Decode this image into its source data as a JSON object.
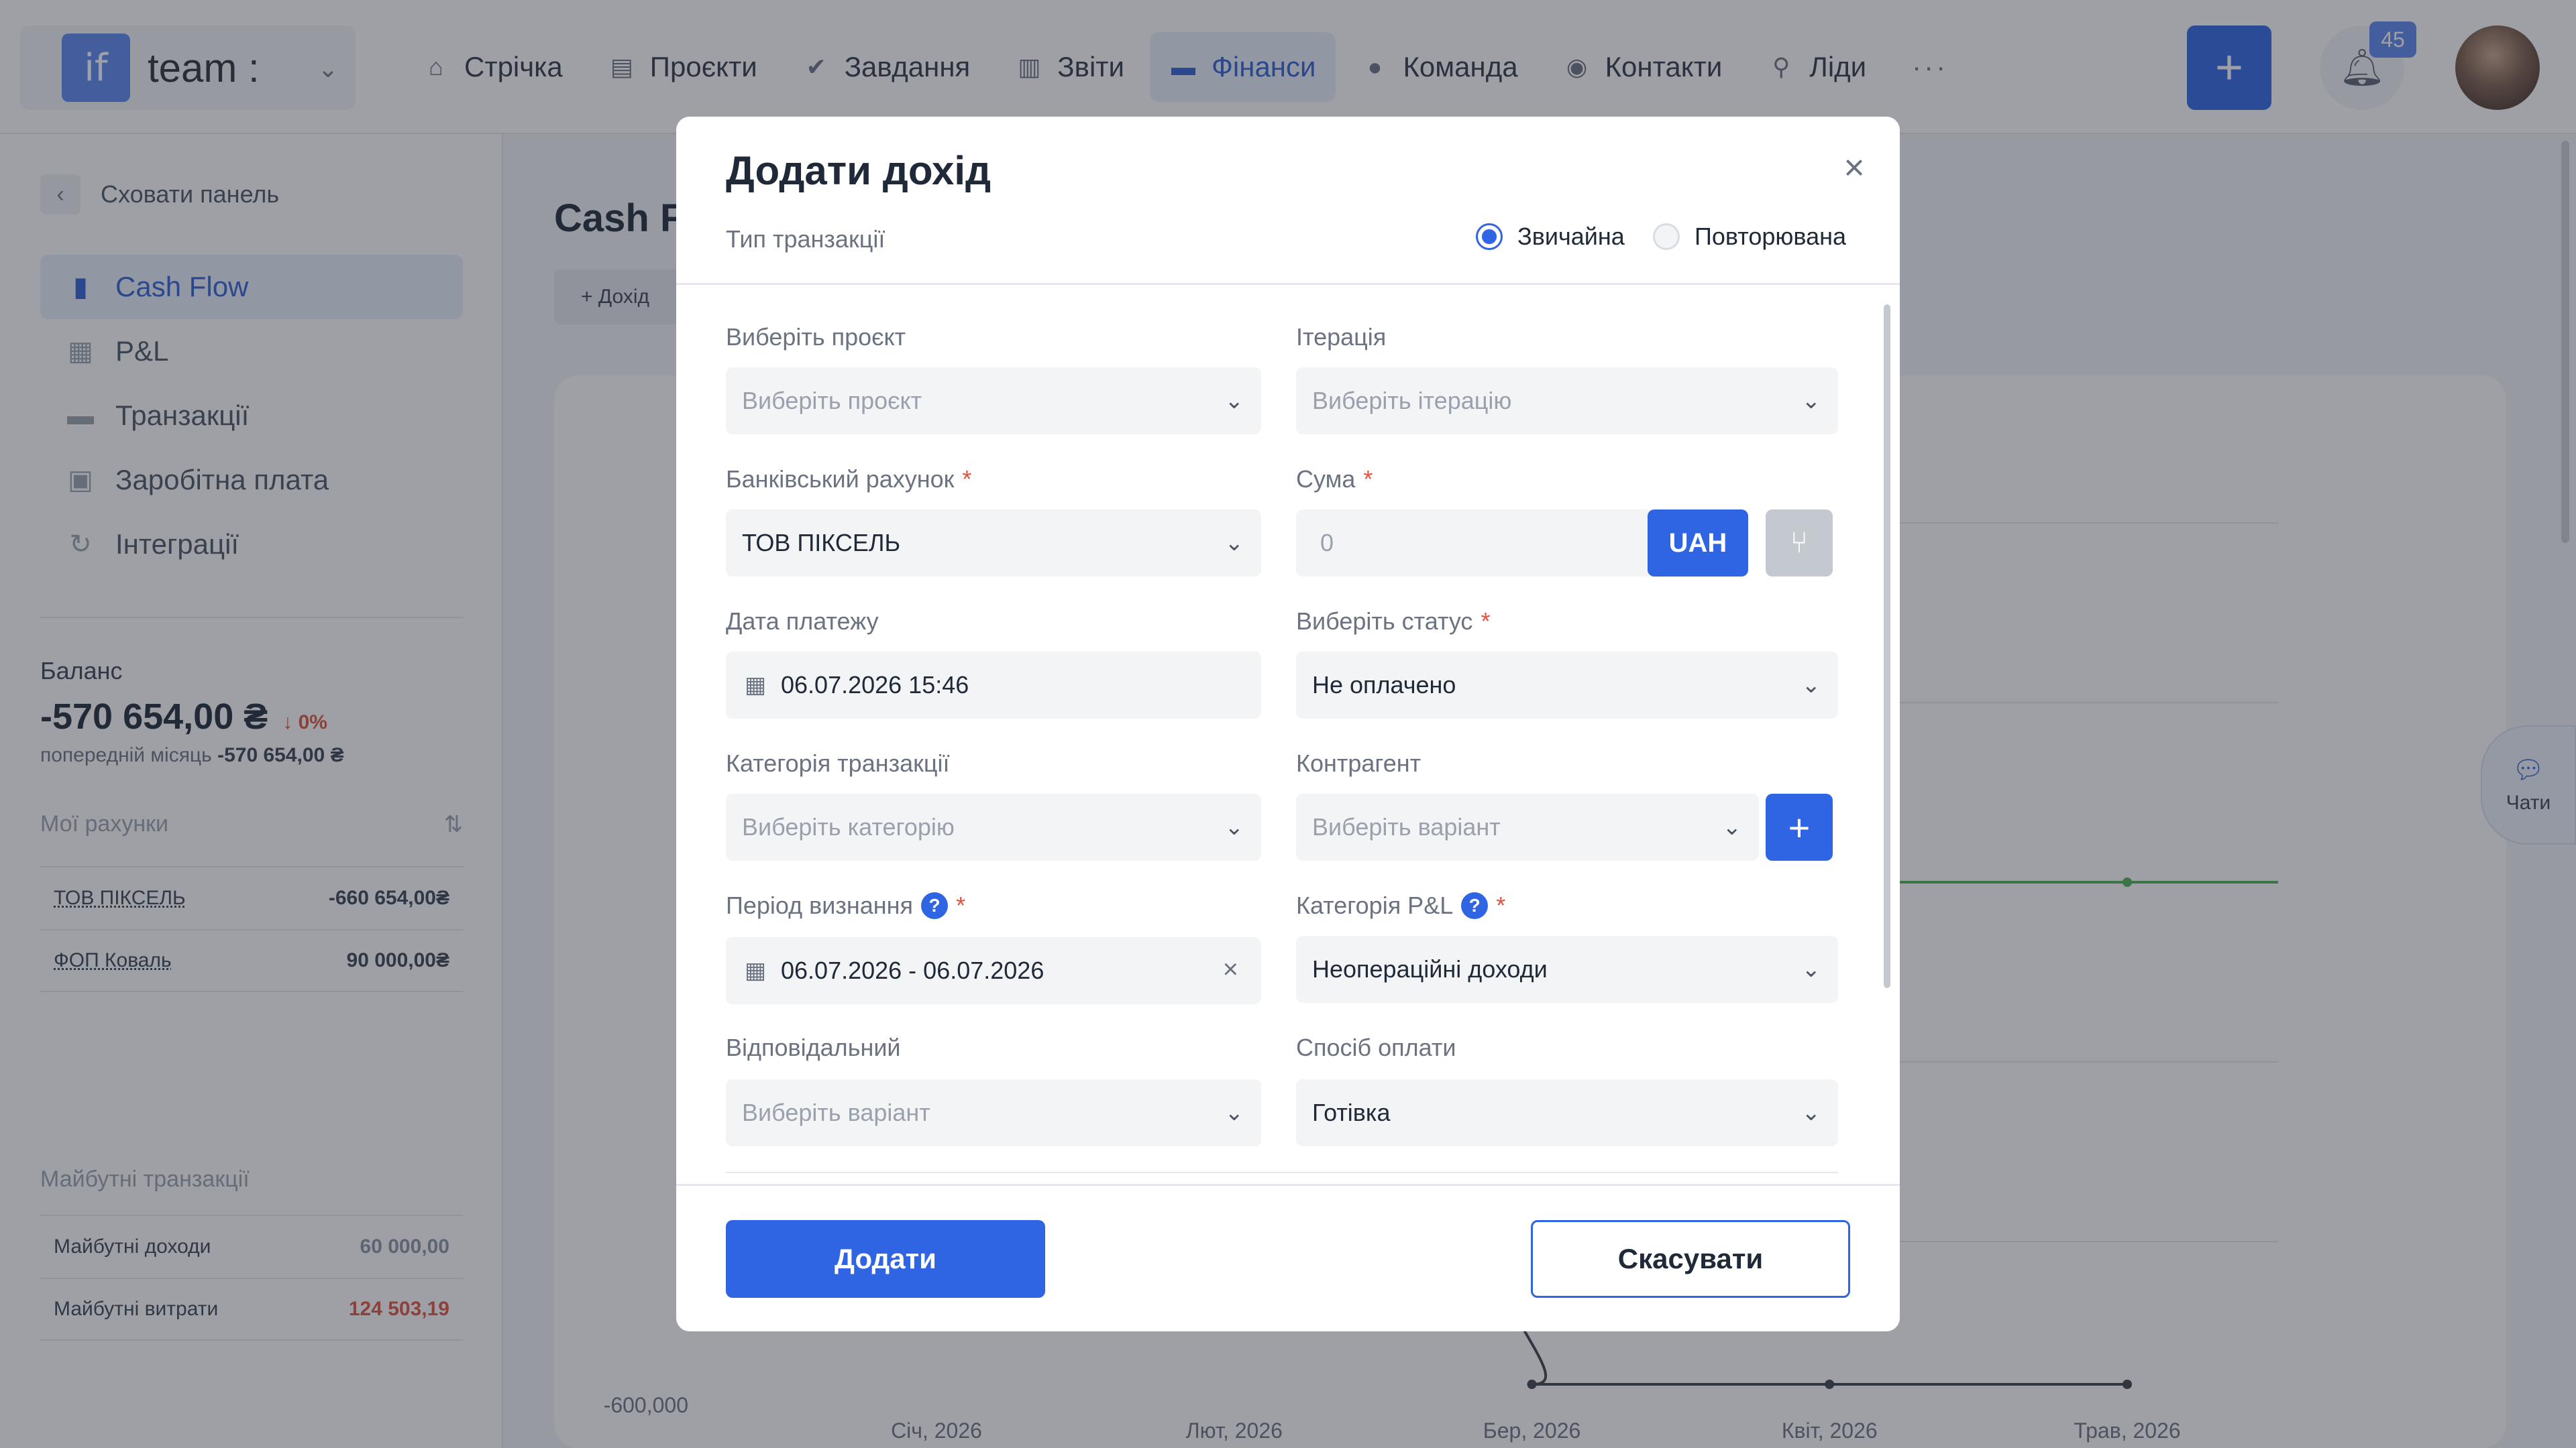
{
  "topbar": {
    "brand": {
      "logo": "if",
      "name": "team :"
    },
    "nav": [
      {
        "label": "Стрічка",
        "icon": "home-icon"
      },
      {
        "label": "Проєкти",
        "icon": "document-icon"
      },
      {
        "label": "Завдання",
        "icon": "check-circle-icon"
      },
      {
        "label": "Звіти",
        "icon": "report-icon"
      },
      {
        "label": "Фінанси",
        "icon": "wallet-icon",
        "active": true
      },
      {
        "label": "Команда",
        "icon": "user-icon"
      },
      {
        "label": "Контакти",
        "icon": "contacts-icon"
      },
      {
        "label": "Ліди",
        "icon": "leads-icon"
      }
    ],
    "more": "···",
    "add": "+",
    "notifications_count": "45"
  },
  "sidebar": {
    "hide_panel": "Сховати панель",
    "menu": [
      {
        "label": "Cash Flow",
        "icon": "bar-chart-icon",
        "active": true
      },
      {
        "label": "P&L",
        "icon": "calendar-dollar-icon"
      },
      {
        "label": "Транзакції",
        "icon": "card-icon"
      },
      {
        "label": "Заробітна плата",
        "icon": "briefcase-icon"
      },
      {
        "label": "Інтеграції",
        "icon": "sync-icon"
      }
    ],
    "balance": {
      "label": "Баланс",
      "value": "-570 654,00 ₴",
      "change": "0%",
      "prev_label": "попередній місяць",
      "prev_value": "-570 654,00 ₴"
    },
    "accounts": {
      "title": "Мої рахунки",
      "items": [
        {
          "name": "ТОВ ПІКСЕЛЬ",
          "value": "-660 654,00₴"
        },
        {
          "name": "ФОП Коваль",
          "value": "90 000,00₴"
        }
      ]
    },
    "future": {
      "title": "Майбутні транзакції",
      "items": [
        {
          "name": "Майбутні доходи",
          "value": "60 000,00"
        },
        {
          "name": "Майбутні витрати",
          "value": "124 503,19"
        }
      ]
    }
  },
  "main": {
    "title": "Cash F",
    "add_label": "+ Дохід",
    "chats_label": "Чати"
  },
  "chart_data": {
    "type": "line",
    "categories": [
      "Січ, 2026",
      "Лют, 2026",
      "Бер, 2026",
      "Квіт, 2026",
      "Трав, 2026"
    ],
    "ytick_visible": [
      "-600,000"
    ],
    "series": [
      {
        "values": [
          null,
          null,
          -600000,
          -600000,
          -600000
        ],
        "color": "#3a3f4a"
      },
      {
        "values": [
          null,
          null,
          null,
          0,
          0
        ],
        "color": "#4caf50"
      }
    ]
  },
  "modal": {
    "title": "Додати дохід",
    "close": "×",
    "type_label": "Тип транзакції",
    "type_options": [
      {
        "label": "Звичайна",
        "selected": true
      },
      {
        "label": "Повторювана",
        "selected": false
      }
    ],
    "fields": {
      "project": {
        "label": "Виберіть проєкт",
        "placeholder": "Виберіть проєкт"
      },
      "iteration": {
        "label": "Ітерація",
        "placeholder": "Виберіть ітерацію"
      },
      "bank": {
        "label": "Банківський рахунок",
        "value": "ТОВ ПІКСЕЛЬ"
      },
      "amount": {
        "label": "Сума",
        "placeholder": "0",
        "currency": "UAH"
      },
      "pay_date": {
        "label": "Дата платежу",
        "value": "06.07.2026 15:46"
      },
      "status": {
        "label": "Виберіть статус",
        "value": "Не оплачено"
      },
      "category": {
        "label": "Категорія транзакції",
        "placeholder": "Виберіть категорію"
      },
      "counterparty": {
        "label": "Контрагент",
        "placeholder": "Виберіть варіант"
      },
      "period": {
        "label": "Період визнання",
        "value": "06.07.2026 - 06.07.2026"
      },
      "pl_category": {
        "label": "Категорія P&L",
        "value": "Неопераційні доходи"
      },
      "responsible": {
        "label": "Відповідальний",
        "placeholder": "Виберіть варіант"
      },
      "payment_method": {
        "label": "Спосіб оплати",
        "value": "Готівка"
      }
    },
    "submit": "Додати",
    "cancel": "Скасувати"
  }
}
